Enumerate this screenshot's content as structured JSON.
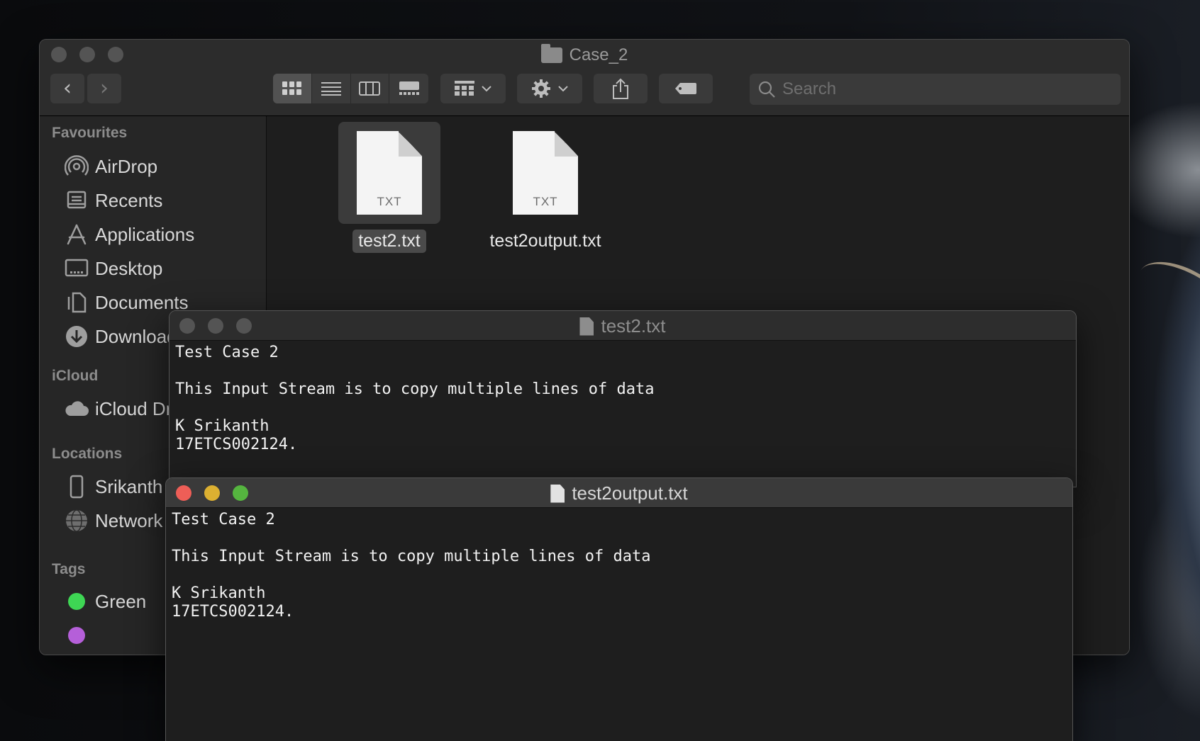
{
  "finder": {
    "title": "Case_2",
    "search": {
      "placeholder": "Search",
      "value": ""
    },
    "sidebar": {
      "favourites_header": "Favourites",
      "favourites": [
        "AirDrop",
        "Recents",
        "Applications",
        "Desktop",
        "Documents",
        "Downloads"
      ],
      "icloud_header": "iCloud",
      "icloud": [
        "iCloud Drive"
      ],
      "locations_header": "Locations",
      "locations": [
        "Srikanth",
        "Network"
      ],
      "tags_header": "Tags",
      "tags": [
        {
          "name": "Green",
          "color": "#3ed654"
        }
      ]
    },
    "files": [
      {
        "name": "test2.txt",
        "ext": "TXT",
        "selected": true
      },
      {
        "name": "test2output.txt",
        "ext": "TXT",
        "selected": false
      }
    ]
  },
  "text_windows": [
    {
      "title": "test2.txt",
      "active": false,
      "lines": [
        "Test Case 2",
        "",
        "This Input Stream is to copy multiple lines of data",
        "",
        "K Srikanth",
        "17ETCS002124."
      ]
    },
    {
      "title": "test2output.txt",
      "active": true,
      "lines": [
        "Test Case 2",
        "",
        "This Input Stream is to copy multiple lines of data",
        "",
        "K Srikanth",
        "17ETCS002124."
      ]
    }
  ],
  "icons": {
    "finder_toolbar": [
      "chevron-left-icon",
      "chevron-right-icon",
      "icon-view-icon",
      "list-view-icon",
      "column-view-icon",
      "gallery-view-icon",
      "group-icon",
      "gear-icon",
      "share-icon",
      "tag-icon",
      "search-icon"
    ],
    "sidebar": [
      "airdrop-icon",
      "recents-icon",
      "applications-icon",
      "desktop-icon",
      "documents-icon",
      "downloads-icon",
      "icloud-icon",
      "iphone-icon",
      "network-icon"
    ]
  },
  "colors": {
    "close": "#ee5e57",
    "minimize": "#dcb031",
    "zoom": "#55b53f"
  }
}
